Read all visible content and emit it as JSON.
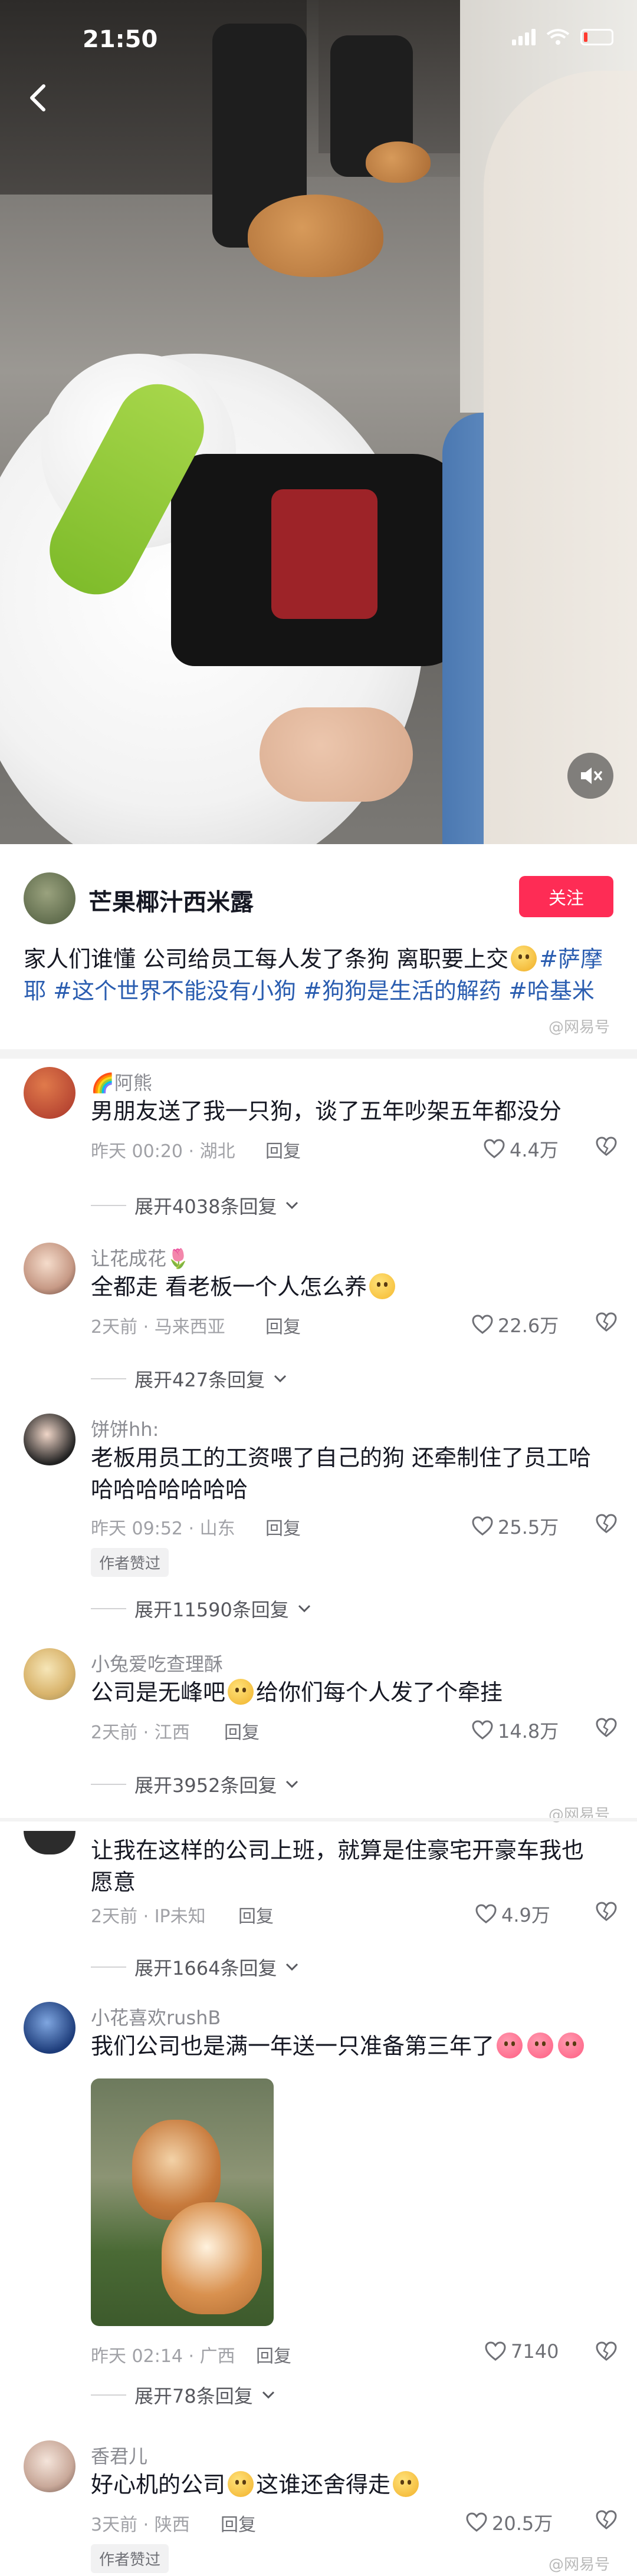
{
  "status_bar": {
    "time": "21:50",
    "battery": "11"
  },
  "video": {
    "back_icon": "chevron-left-icon",
    "mute_icon": "speaker-muted-icon"
  },
  "author": {
    "name": "芒果椰汁西米露",
    "follow_label": "关注"
  },
  "caption": {
    "text": "家人们谁懂 公司给员工每人发了条狗 离职要上交",
    "tags": [
      "#萨摩耶",
      "#这个世界不能没有小狗",
      "#狗狗是生活的解药",
      "#哈基米"
    ]
  },
  "watermarks": [
    "@网易号"
  ],
  "comments": [
    {
      "user": "🌈阿熊",
      "text": "男朋友送了我一只狗，谈了五年吵架五年都没分",
      "meta": "昨天 00:20 · 湖北",
      "reply": "回复",
      "likes": "4.4万",
      "expand": "展开4038条回复"
    },
    {
      "user": "让花成花🌷",
      "text": "全都走 看老板一个人怎么养",
      "meta": "2天前 · 马来西亚",
      "reply": "回复",
      "likes": "22.6万",
      "expand": "展开427条回复"
    },
    {
      "user": "饼饼hh:",
      "text": "老板用员工的工资喂了自己的狗 还牵制住了员工哈哈哈哈哈哈哈哈",
      "meta": "昨天 09:52 · 山东",
      "reply": "回复",
      "likes": "25.5万",
      "badge": "作者赞过",
      "expand": "展开11590条回复"
    },
    {
      "user": "小兔爱吃查理酥",
      "text": "公司是无峰吧",
      "text2": "给你们每个人发了个牵挂",
      "meta": "2天前 · 江西",
      "reply": "回复",
      "likes": "14.8万",
      "expand": "展开3952条回复"
    },
    {
      "user": "",
      "text": "让我在这样的公司上班，就算是住豪宅开豪车我也愿意",
      "meta": "2天前 · IP未知",
      "reply": "回复",
      "likes": "4.9万",
      "expand": "展开1664条回复"
    },
    {
      "user": "小花喜欢rushB",
      "text": "我们公司也是满一年送一只准备第三年了",
      "meta": "昨天 02:14 · 广西",
      "reply": "回复",
      "likes": "7140",
      "expand": "展开78条回复"
    },
    {
      "user": "香君儿",
      "text": "好心机的公司",
      "text2": "这谁还舍得走",
      "meta": "3天前 · 陕西",
      "reply": "回复",
      "likes": "20.5万",
      "badge": "作者赞过"
    }
  ],
  "colors": {
    "follow": "#fe2c55",
    "tag": "#2a5db0",
    "muted_text": "#a0a1a6"
  }
}
